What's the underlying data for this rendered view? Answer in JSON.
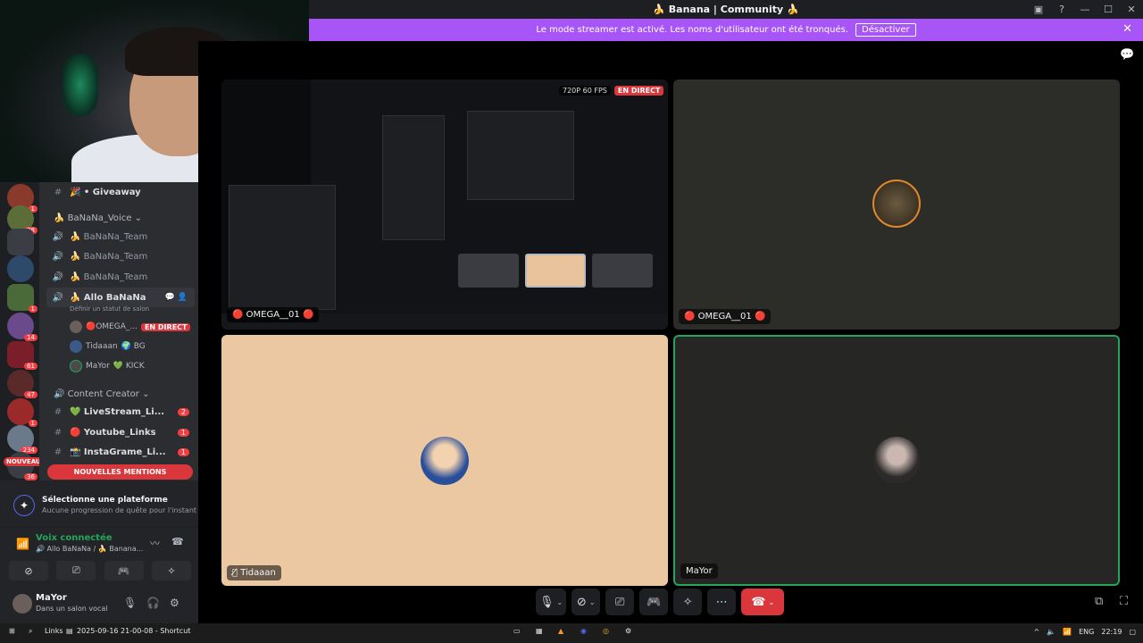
{
  "window": {
    "title": "🍌 Banana | Community 🍌"
  },
  "banner": {
    "text": "Le mode streamer est activé. Les noms d'utilisateur ont été tronqués.",
    "button": "Désactiver"
  },
  "guild_badges": [
    "1",
    "28",
    "",
    "",
    "1",
    "14",
    "61",
    "47",
    "1",
    "234",
    "36"
  ],
  "sidebar": {
    "channels": [
      {
        "label": "🎉 • Giveaway",
        "count": ""
      }
    ],
    "voice_category": "BaNaNa_Voice",
    "voice_channels": [
      "🍌 BaNaNa_Team",
      "🍌 BaNaNa_Team",
      "🍌 BaNaNa_Team"
    ],
    "active_voice": {
      "label": "🍌 Allo BaNaNa",
      "status": "Définir un statut de salon"
    },
    "voice_users": [
      {
        "name": "🔴OMEGA_...",
        "badge": "EN DIRECT"
      },
      {
        "name": "Tidaaan",
        "badge": "🌍 BG"
      },
      {
        "name": "MaYor",
        "badge": "💚 KICK"
      }
    ],
    "content_category": "Content Creator",
    "content_channels": [
      {
        "label": "💚 LiveStream_Li...",
        "count": "2"
      },
      {
        "label": "🔴 Youtube_Links",
        "count": "1"
      },
      {
        "label": "📸 InstaGrame_Li...",
        "count": "1"
      }
    ],
    "nouveau": "NOUVEAU",
    "mentions": "NOUVELLES MENTIONS"
  },
  "quest": {
    "title": "Sélectionne une plateforme",
    "subtitle": "Aucune progression de quête pour l'instant"
  },
  "voice": {
    "title": "Voix connectée",
    "subtitle": "🔊 Allo BaNaNa / 🍌 Banana..."
  },
  "user": {
    "name": "MaYor",
    "status": "Dans un salon vocal"
  },
  "stage": {
    "screenshare": {
      "quality": "720P 60 FPS",
      "live": "EN DIRECT",
      "name": "🔴 OMEGA__01 🔴"
    },
    "tiles": [
      {
        "name": "🔴 OMEGA__01 🔴"
      },
      {
        "name": "Tidaaan"
      },
      {
        "name": "MaYor"
      }
    ]
  },
  "taskbar": {
    "links": "Links",
    "doc": "2025-09-16 21-00-08 - Shortcut",
    "lang": "ENG",
    "time": "22:19"
  },
  "colors": {
    "accent": "#5865f2",
    "live": "#da373c",
    "banner": "#a855f7",
    "speaking": "#23a55a"
  }
}
